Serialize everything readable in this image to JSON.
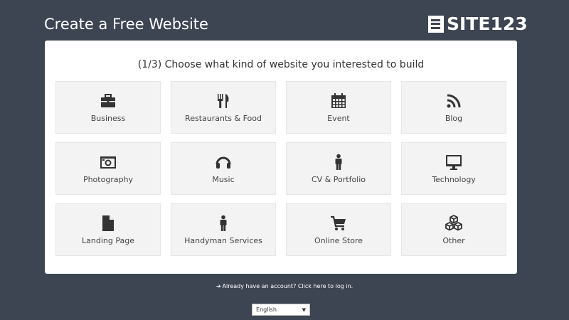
{
  "header": {
    "title": "Create a Free Website",
    "logo_text": "SITE123"
  },
  "panel": {
    "subtitle": "(1/3) Choose what kind of website you interested to build",
    "categories": [
      {
        "label": "Business",
        "icon": "briefcase-icon"
      },
      {
        "label": "Restaurants & Food",
        "icon": "fork-knife-icon"
      },
      {
        "label": "Event",
        "icon": "calendar-icon"
      },
      {
        "label": "Blog",
        "icon": "rss-icon"
      },
      {
        "label": "Photography",
        "icon": "camera-icon"
      },
      {
        "label": "Music",
        "icon": "headphones-icon"
      },
      {
        "label": "CV & Portfolio",
        "icon": "person-icon"
      },
      {
        "label": "Technology",
        "icon": "monitor-icon"
      },
      {
        "label": "Landing Page",
        "icon": "document-icon"
      },
      {
        "label": "Handyman Services",
        "icon": "person-icon"
      },
      {
        "label": "Online Store",
        "icon": "shopping-cart-icon"
      },
      {
        "label": "Other",
        "icon": "cubes-icon"
      }
    ]
  },
  "footer": {
    "login_text": "Already have an account? Click here to log in.",
    "language": "English"
  },
  "colors": {
    "background": "#3d4452",
    "tile": "#f3f3f3",
    "icon": "#333333"
  }
}
